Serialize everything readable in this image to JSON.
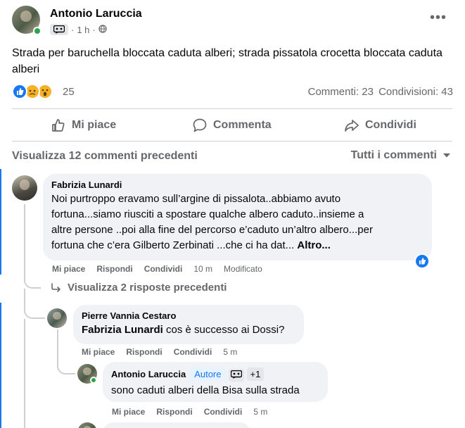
{
  "post": {
    "author": "Antonio Laruccia",
    "time": "1 h",
    "separator": "·",
    "text": "Strada per baruchella bloccata caduta alberi; strada pissatola crocetta bloccata caduta alberi",
    "reaction_count": "25",
    "comments_label": "Commenti: 23",
    "shares_label": "Condivisioni: 43",
    "reactions": [
      "like",
      "sad",
      "wow"
    ]
  },
  "actions": {
    "like": "Mi piace",
    "comment": "Commenta",
    "share": "Condividi"
  },
  "comments_header": {
    "view_previous": "Visualizza 12 commenti precedenti",
    "sort": "Tutti i commenti"
  },
  "comments": [
    {
      "author": "Fabrizia Lunardi",
      "lines": [
        "Noi purtroppo eravamo sull’argine di pissalota..abbiamo avuto",
        "fortuna...siamo riusciti a spostare qualche albero caduto..insieme a",
        "altre persone ..poi alla fine del percorso e’caduto un’altro albero...per",
        "fortuna che c’era Gilberto Zerbinati ...che ci ha dat..."
      ],
      "more": "Altro...",
      "like": "Mi piace",
      "reply": "Rispondi",
      "share": "Condividi",
      "time": "10 m",
      "edited": "Modificato"
    }
  ],
  "view_replies": "Visualizza 2 risposte precedenti",
  "replies": [
    {
      "author": "Pierre Vannia Cestaro",
      "mention": "Fabrizia Lunardi",
      "text": " cos è successo ai Dossi?",
      "like": "Mi piace",
      "reply": "Rispondi",
      "share": "Condividi",
      "time": "5 m"
    },
    {
      "author": "Antonio Laruccia",
      "role": "Autore",
      "plus": "+1",
      "text": "sono caduti alberi della Bisa sulla strada",
      "like": "Mi piace",
      "reply": "Rispondi",
      "share": "Condividi",
      "time": "5 m"
    }
  ],
  "colors": {
    "accent": "#1877f2",
    "muted": "#65676b",
    "bubble": "#f0f2f5",
    "online": "#31a24c"
  }
}
